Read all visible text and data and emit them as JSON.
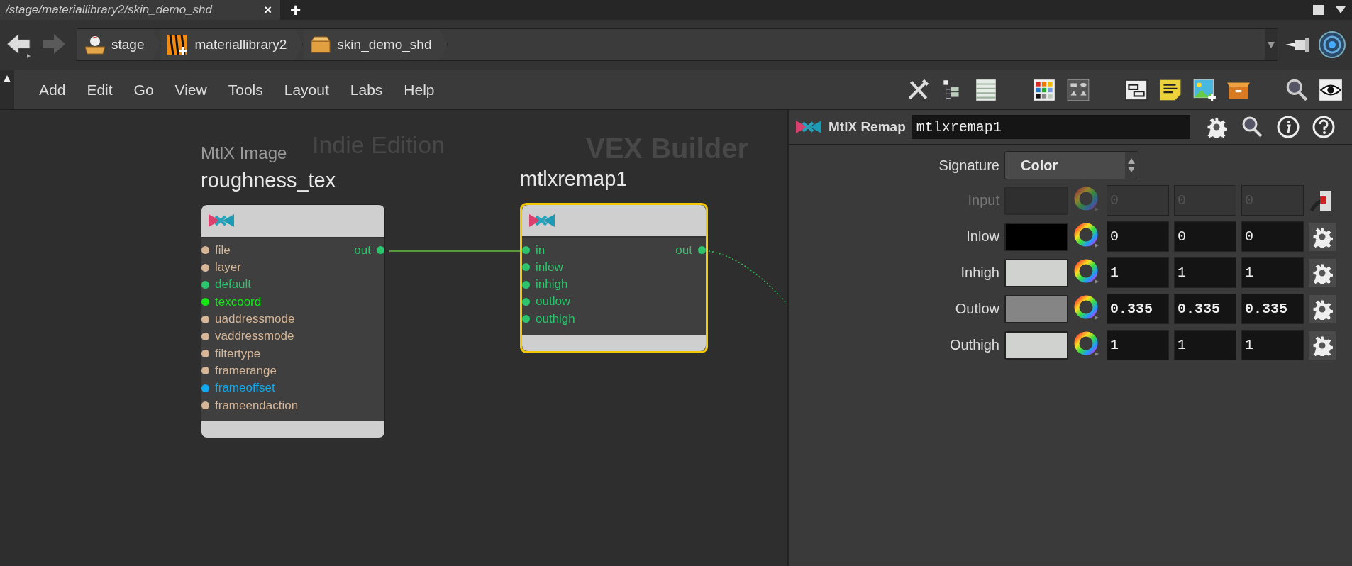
{
  "tab": {
    "label": "/stage/materiallibrary2/skin_demo_shd",
    "close": "×"
  },
  "new_tab": "+",
  "path": [
    {
      "label": "stage"
    },
    {
      "label": "materiallibrary2"
    },
    {
      "label": "skin_demo_shd"
    }
  ],
  "menu": [
    "Add",
    "Edit",
    "Go",
    "View",
    "Tools",
    "Layout",
    "Labs",
    "Help"
  ],
  "canvas": {
    "edition_label": "Indie Edition",
    "context_label": "VEX Builder",
    "nodes": [
      {
        "type_label": "MtlX Image",
        "name": "roughness_tex",
        "selected": false,
        "output": "out",
        "inputs": [
          {
            "name": "file",
            "color": "#d6b696"
          },
          {
            "name": "layer",
            "color": "#d6b696"
          },
          {
            "name": "default",
            "color": "#2ec46e"
          },
          {
            "name": "texcoord",
            "color": "#16e816"
          },
          {
            "name": "uaddressmode",
            "color": "#d6b696"
          },
          {
            "name": "vaddressmode",
            "color": "#d6b696"
          },
          {
            "name": "filtertype",
            "color": "#d6b696"
          },
          {
            "name": "framerange",
            "color": "#d6b696"
          },
          {
            "name": "frameoffset",
            "color": "#10aaf0"
          },
          {
            "name": "frameendaction",
            "color": "#d6b696"
          }
        ]
      },
      {
        "name": "mtlxremap1",
        "selected": true,
        "output": "out",
        "inputs": [
          {
            "name": "in",
            "color": "#2ec46e"
          },
          {
            "name": "inlow",
            "color": "#2ec46e"
          },
          {
            "name": "inhigh",
            "color": "#2ec46e"
          },
          {
            "name": "outlow",
            "color": "#2ec46e"
          },
          {
            "name": "outhigh",
            "color": "#2ec46e"
          }
        ]
      }
    ]
  },
  "params": {
    "node_type": "MtlX Remap",
    "node_name": "mtlxremap1",
    "signature": {
      "label": "Signature",
      "value": "Color"
    },
    "rows": [
      {
        "label": "Input",
        "disabled": true,
        "modified": false,
        "color": "#2f2f2f",
        "values": [
          "0",
          "0",
          "0"
        ]
      },
      {
        "label": "Inlow",
        "disabled": false,
        "modified": false,
        "color": "#000000",
        "values": [
          "0",
          "0",
          "0"
        ]
      },
      {
        "label": "Inhigh",
        "disabled": false,
        "modified": false,
        "color": "#d0d2d0",
        "values": [
          "1",
          "1",
          "1"
        ]
      },
      {
        "label": "Outlow",
        "disabled": false,
        "modified": true,
        "color": "#858585",
        "values": [
          "0.335",
          "0.335",
          "0.335"
        ]
      },
      {
        "label": "Outhigh",
        "disabled": false,
        "modified": false,
        "color": "#d0d2d0",
        "values": [
          "1",
          "1",
          "1"
        ]
      }
    ]
  }
}
